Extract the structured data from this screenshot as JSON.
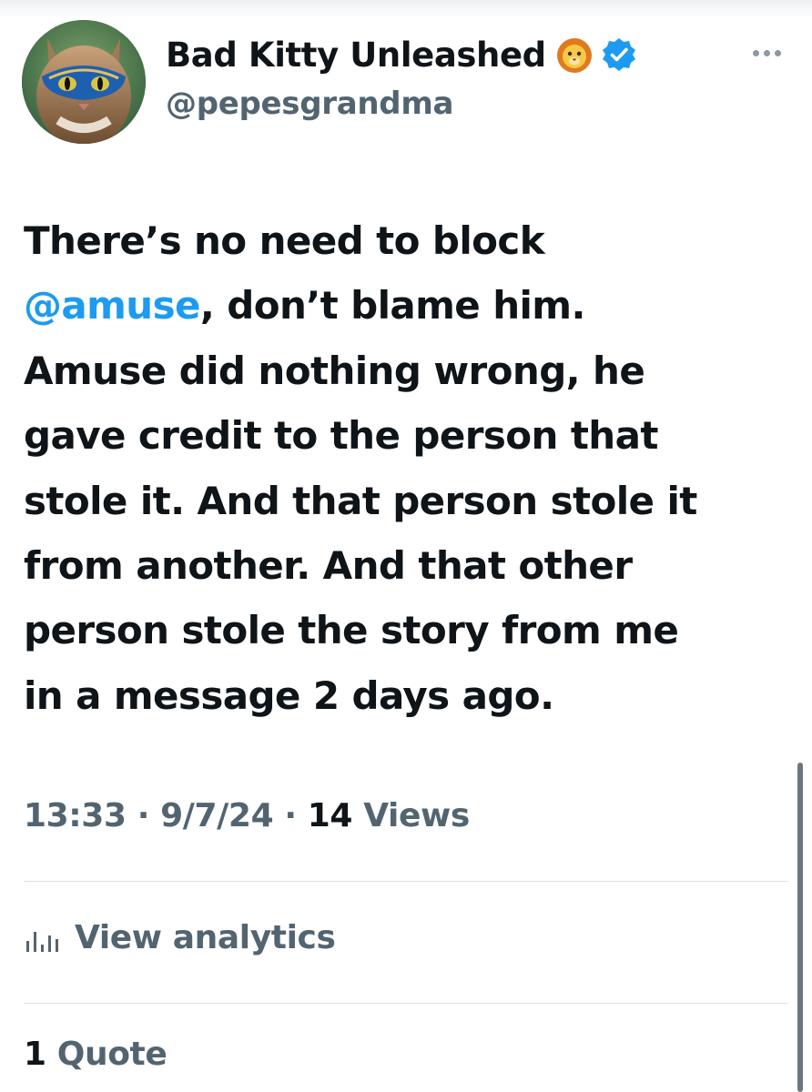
{
  "author": {
    "display_name": "Bad Kitty Unleashed",
    "name_emoji": "lion-face-icon",
    "verified_icon": "verified-badge-icon",
    "handle": "@pepesgrandma",
    "avatar_icon": "cat-with-blue-mask-avatar"
  },
  "tweet": {
    "lines": [
      "There’s no need to block",
      ", don’t blame him.",
      "Amuse did nothing wrong, he",
      "gave credit to the person that",
      "stole it. And that person stole it",
      "from another. And that other",
      "person stole the story from me",
      "in a message 2 days ago."
    ],
    "mention": "@amuse"
  },
  "meta": {
    "time": "13:33",
    "separator": " · ",
    "date": "9/7/24",
    "views_count": "14",
    "views_label": " Views"
  },
  "analytics": {
    "label": "View analytics",
    "icon": "bar-chart-icon"
  },
  "engagement": {
    "quotes_count": "1",
    "quotes_label": " Quote"
  },
  "colors": {
    "text": "#0f1419",
    "secondary": "#536471",
    "link": "#1d9bf0",
    "verified": "#1d9bf0",
    "divider": "#dde3e8"
  }
}
